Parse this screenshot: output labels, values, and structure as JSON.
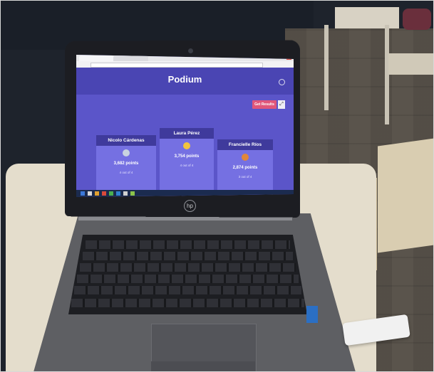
{
  "browser": {
    "tab1": "",
    "tab2": ""
  },
  "app": {
    "title": "Podium",
    "settings_icon": "gear-icon",
    "get_results_label": "Get Results",
    "expand_icon": "fullscreen-icon"
  },
  "podium": [
    {
      "name": "Nicolo Cárdenas",
      "points": "3,682 points",
      "correct": "4 out of 4",
      "medal_color": "#c9d3e0"
    },
    {
      "name": "Laura Pérez",
      "points": "3,754 points",
      "correct": "4 out of 4",
      "medal_color": "#f2c43d"
    },
    {
      "name": "Francielle Ríos",
      "points": "2,874 points",
      "correct": "3 out of 4",
      "medal_color": "#e2873b"
    }
  ],
  "colors": {
    "screen_bg": "#5b55c9",
    "header_bg": "#4a45b3",
    "accent_button": "#e0567a"
  }
}
